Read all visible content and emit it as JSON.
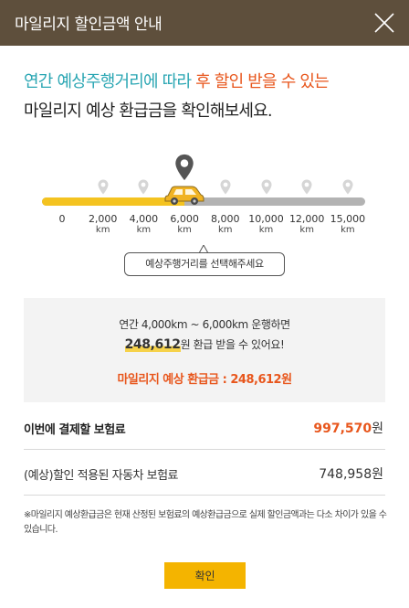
{
  "header": {
    "title": "마일리지 할인금액 안내"
  },
  "headline": {
    "part1": "연간 예상주행거리에 따라 ",
    "part2": "후 할인 받을 수 있는",
    "line2": "마일리지 예상 환급금을 확인해보세요."
  },
  "slider": {
    "value_km": 6000,
    "unit": "km",
    "ticks": [
      {
        "label": "0",
        "unit": ""
      },
      {
        "label": "2,000",
        "unit": "km"
      },
      {
        "label": "4,000",
        "unit": "km"
      },
      {
        "label": "6,000",
        "unit": "km"
      },
      {
        "label": "8,000",
        "unit": "km"
      },
      {
        "label": "10,000",
        "unit": "km"
      },
      {
        "label": "12,000",
        "unit": "km"
      },
      {
        "label": "15,000",
        "unit": "km"
      }
    ]
  },
  "tooltip": {
    "text": "예상주행거리를 선택해주세요"
  },
  "info": {
    "range_text": "연간 4,000km ~ 6,000km 운행하면",
    "refund_amount": "248,612",
    "refund_suffix": "원 환급 받을 수 있어요!",
    "refund_label": "마일리지 예상 환급금 : 248,612원"
  },
  "rows": {
    "pay": {
      "label": "이번에 결제할 보험료",
      "value": "997,570",
      "currency": "원"
    },
    "discounted": {
      "label": "(예상)할인 적용된 자동차 보험료",
      "value": "748,958원"
    }
  },
  "note": {
    "text": "※마일리지 예상환급금은 현재 산정된 보험료의 예상환급금으로 실제 할인금액과는 다소 차이가 있을 수 있습니다."
  },
  "buttons": {
    "confirm": "확인"
  },
  "colors": {
    "header_bg": "#5e4f3c",
    "accent_orange": "#e8561c",
    "accent_teal": "#2aa6b3",
    "slider_yellow": "#f4c320",
    "button_yellow": "#f4b400"
  }
}
